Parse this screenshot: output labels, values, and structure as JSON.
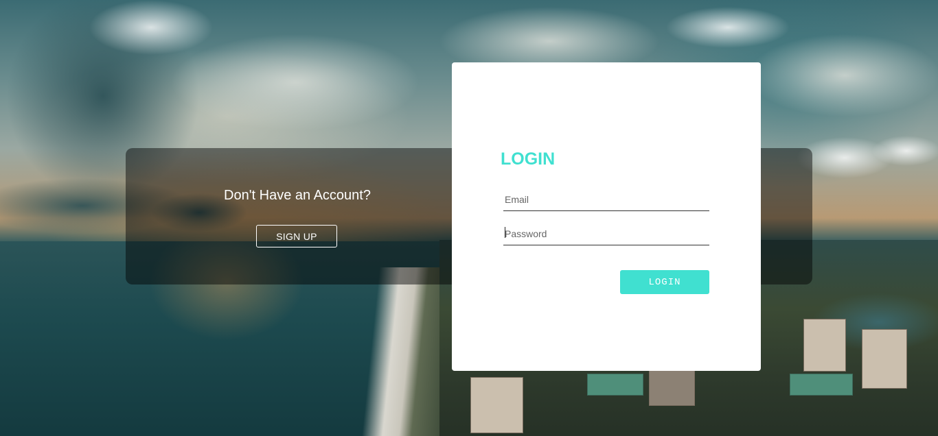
{
  "signup": {
    "prompt": "Don't Have an Account?",
    "button_label": "SIGN UP"
  },
  "login": {
    "title": "LOGIN",
    "email_placeholder": "Email",
    "email_value": "",
    "password_placeholder": "Password",
    "password_value": "",
    "button_label": "LOGIN"
  },
  "colors": {
    "accent": "#40e0d0",
    "overlay": "rgba(0,0,0,0.45)",
    "card": "#ffffff"
  },
  "background": {
    "icon": "aerial-coast-photo"
  }
}
